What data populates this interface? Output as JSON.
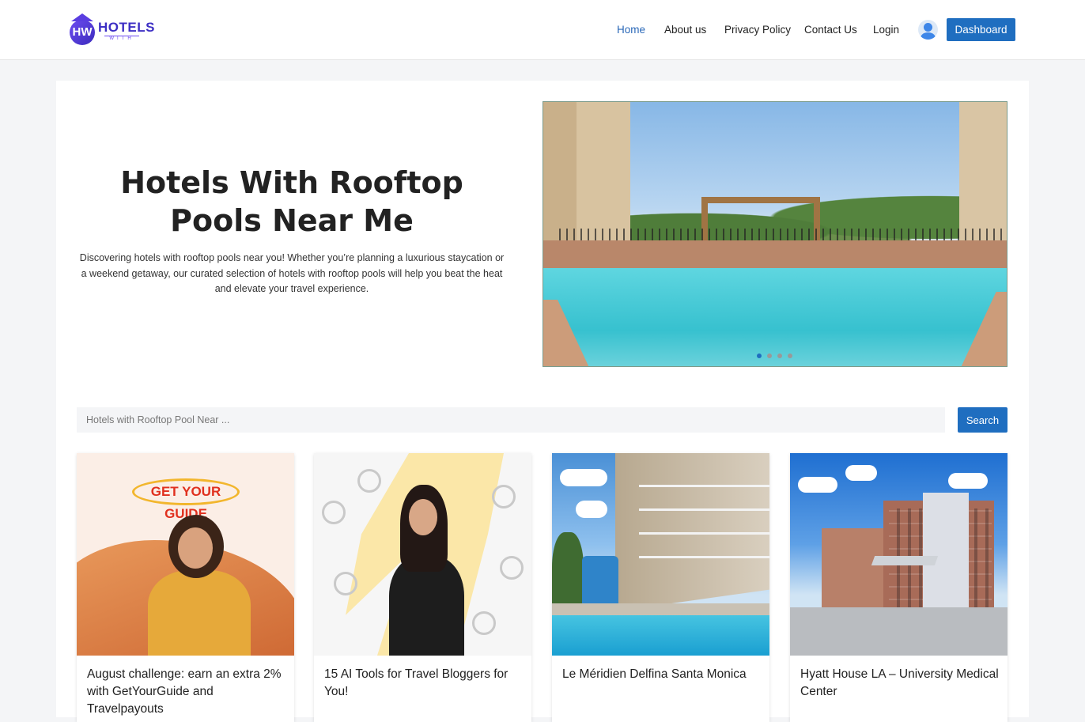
{
  "brand": {
    "logo_word": "HOTELS",
    "logo_sub": "WITH",
    "logo_mono": "HW"
  },
  "nav": {
    "items": [
      {
        "label": "Home",
        "active": true
      },
      {
        "label": "About us",
        "active": false
      },
      {
        "label": "Privacy Policy",
        "active": false
      },
      {
        "label": "Contact Us",
        "active": false
      },
      {
        "label": "Login",
        "active": false
      }
    ],
    "dashboard_label": "Dashboard",
    "user_icon": "user-avatar-icon"
  },
  "hero": {
    "title": "Hotels With Rooftop Pools Near Me",
    "description": "Discovering hotels with rooftop pools near you! Whether you’re planning a luxurious staycation or a weekend getaway, our curated selection of hotels with rooftop pools will help you beat the heat and elevate your travel experience.",
    "slider": {
      "slide_count": 4,
      "active_index": 0
    }
  },
  "search": {
    "placeholder": "Hotels with Rooftop Pool Near ...",
    "value": "",
    "button_label": "Search"
  },
  "cards": [
    {
      "title": "August challenge: earn an extra 2% with GetYourGuide and Travelpayouts",
      "image_text": "GET YOUR GUIDE"
    },
    {
      "title": "15 AI Tools for Travel Bloggers for You!"
    },
    {
      "title": "Le Méridien Delfina Santa Monica"
    },
    {
      "title": "Hyatt House LA – University Medical Center"
    }
  ],
  "colors": {
    "accent": "#1f6ec0",
    "nav_active": "#2a68b8",
    "brand": "#3d2fc4",
    "page_bg": "#f4f5f7"
  }
}
